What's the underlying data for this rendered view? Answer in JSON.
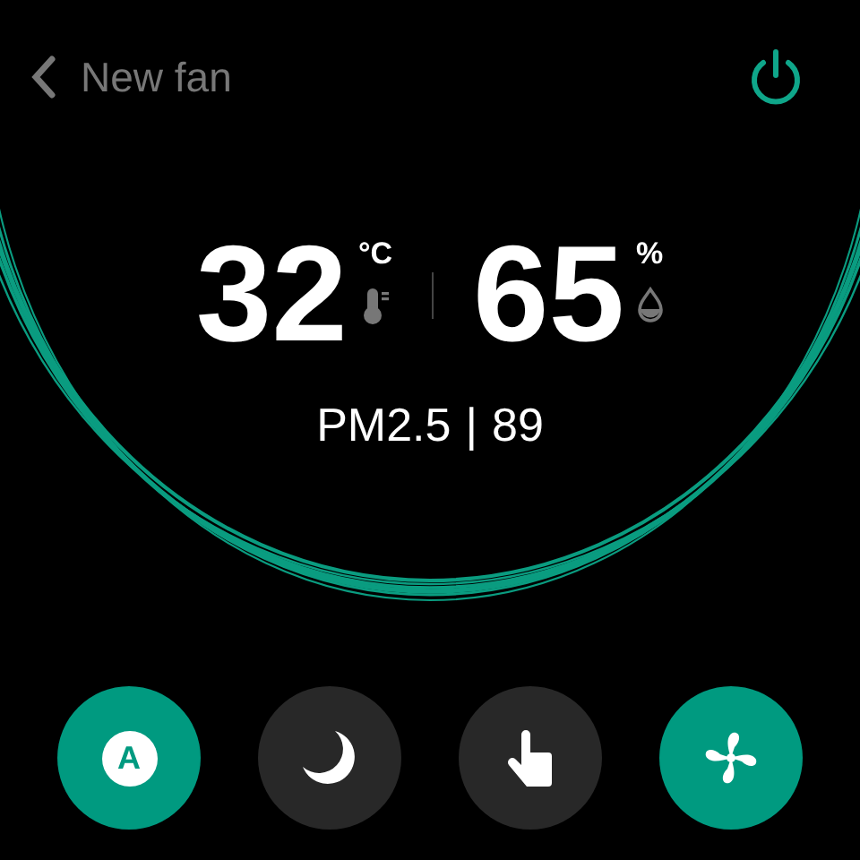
{
  "header": {
    "title": "New fan",
    "power_on": true
  },
  "readings": [
    {
      "kind": "temperature",
      "value": "32",
      "unit": "°C"
    },
    {
      "kind": "humidity",
      "value": "65",
      "unit": "%"
    }
  ],
  "air_quality": {
    "label": "PM2.5",
    "separator": "|",
    "value": "89"
  },
  "modes": [
    {
      "kind": "auto",
      "label": "A",
      "selected": true
    },
    {
      "kind": "sleep",
      "selected": false
    },
    {
      "kind": "manual",
      "selected": false
    },
    {
      "kind": "fan",
      "selected": true
    }
  ]
}
